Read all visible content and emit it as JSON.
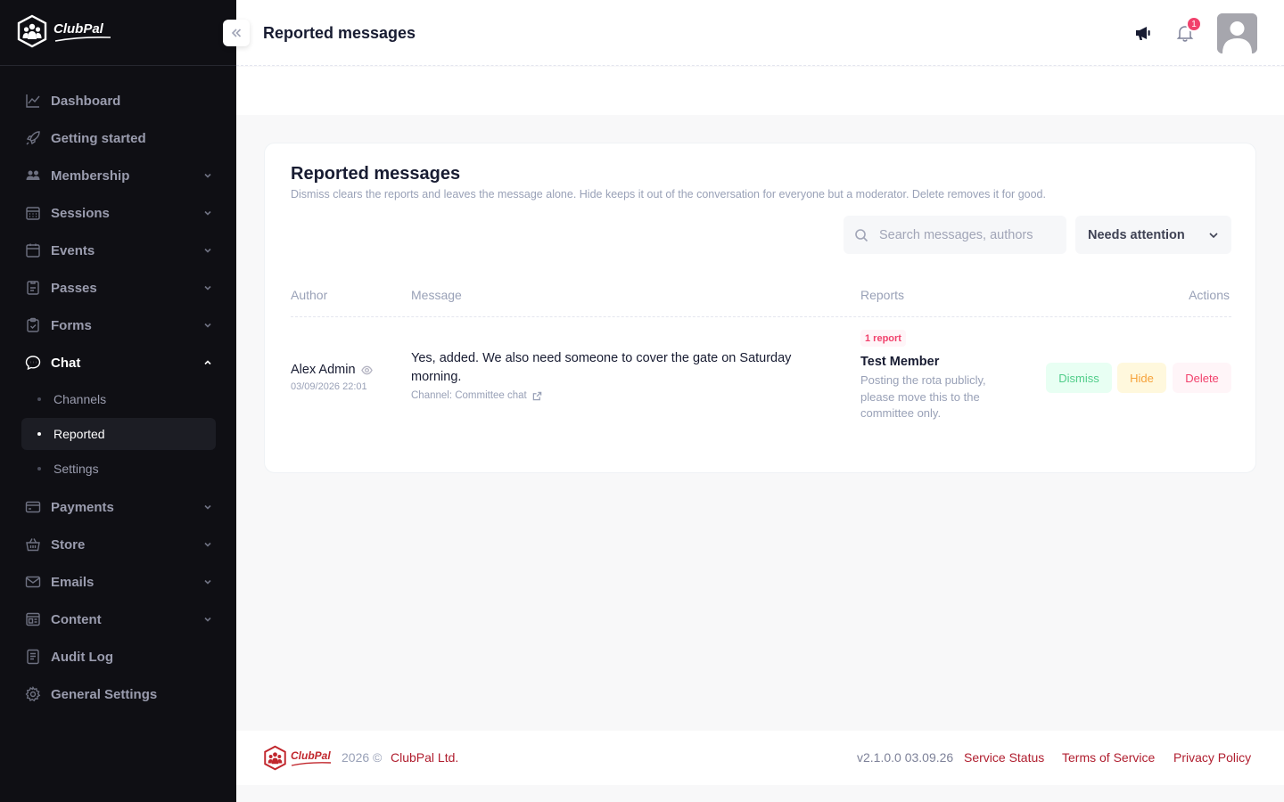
{
  "app": {
    "name": "ClubPal"
  },
  "sidebar": {
    "items": [
      {
        "label": "Dashboard",
        "icon": "chart-line-icon",
        "has_children": false
      },
      {
        "label": "Getting started",
        "icon": "rocket-icon",
        "has_children": false
      },
      {
        "label": "Membership",
        "icon": "people-icon",
        "has_children": true
      },
      {
        "label": "Sessions",
        "icon": "calendar-grid-icon",
        "has_children": true
      },
      {
        "label": "Events",
        "icon": "calendar-icon",
        "has_children": true
      },
      {
        "label": "Passes",
        "icon": "pass-icon",
        "has_children": true
      },
      {
        "label": "Forms",
        "icon": "clipboard-icon",
        "has_children": true
      },
      {
        "label": "Chat",
        "icon": "chat-icon",
        "has_children": true,
        "expanded": true,
        "children": [
          {
            "label": "Channels"
          },
          {
            "label": "Reported",
            "selected": true
          },
          {
            "label": "Settings"
          }
        ]
      },
      {
        "label": "Payments",
        "icon": "card-icon",
        "has_children": true
      },
      {
        "label": "Store",
        "icon": "basket-icon",
        "has_children": true
      },
      {
        "label": "Emails",
        "icon": "envelope-icon",
        "has_children": true
      },
      {
        "label": "Content",
        "icon": "content-icon",
        "has_children": true
      },
      {
        "label": "Audit Log",
        "icon": "log-icon",
        "has_children": false
      },
      {
        "label": "General Settings",
        "icon": "gear-icon",
        "has_children": false
      }
    ]
  },
  "header": {
    "title": "Reported messages",
    "notifications_count": "1"
  },
  "card": {
    "title": "Reported messages",
    "description": "Dismiss clears the reports and leaves the message alone. Hide keeps it out of the conversation for everyone but a moderator. Delete removes it for good.",
    "search_placeholder": "Search messages, authors",
    "filter_value": "Needs attention",
    "columns": {
      "author": "Author",
      "message": "Message",
      "reports": "Reports",
      "actions": "Actions"
    },
    "rows": [
      {
        "author": "Alex Admin",
        "time": "03/09/2026 22:01",
        "message": "Yes, added. We also need someone to cover the gate on Saturday morning.",
        "channel": "Channel: Committee chat",
        "report_count": "1 report",
        "reporter": "Test Member",
        "report_note": "Posting the rota publicly, please move this to the committee only.",
        "actions": {
          "dismiss": "Dismiss",
          "hide": "Hide",
          "delete": "Delete"
        }
      }
    ]
  },
  "footer": {
    "logo_text": "ClubPal",
    "year": "2026 ©",
    "company": "ClubPal Ltd.",
    "version": "v2.1.0.0 03.09.26",
    "links": [
      "Service Status",
      "Terms of Service",
      "Privacy Policy"
    ]
  },
  "colors": {
    "sidebar_bg": "#0f0f14",
    "brand_red": "#b01e2f",
    "success": "#50cd89",
    "warning": "#f6a23a",
    "danger": "#f1416c"
  }
}
